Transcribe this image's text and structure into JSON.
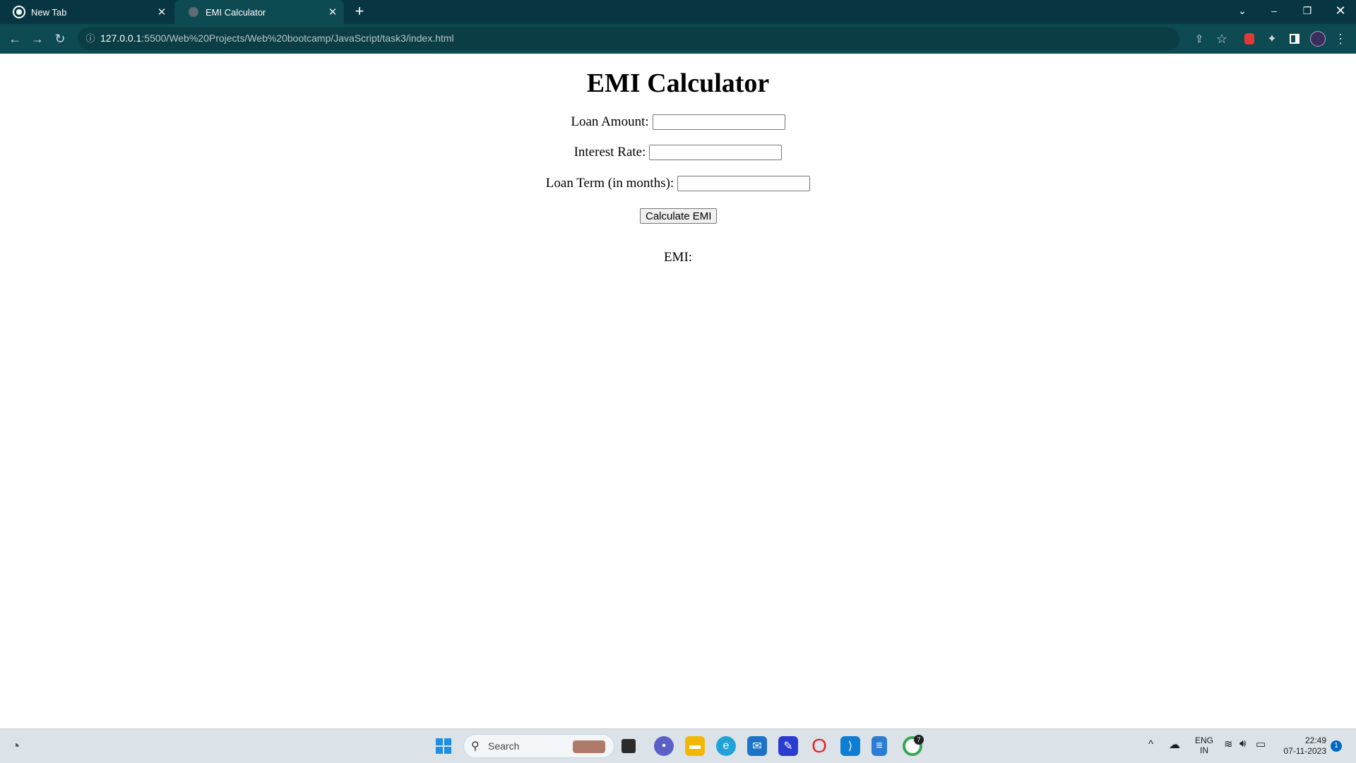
{
  "browser": {
    "tabs": [
      {
        "label": "New Tab",
        "active": false
      },
      {
        "label": "EMI Calculator",
        "active": true
      }
    ],
    "address": {
      "host": "127.0.0.1",
      "rest": ":5500/Web%20Projects/Web%20bootcamp/JavaScript/task3/index.html"
    }
  },
  "page": {
    "heading": "EMI Calculator",
    "fields": [
      {
        "label": "Loan Amount:",
        "value": ""
      },
      {
        "label": "Interest Rate:",
        "value": ""
      },
      {
        "label": "Loan Term (in months):",
        "value": ""
      }
    ],
    "button_label": "Calculate EMI",
    "result_label": "EMI:"
  },
  "taskbar": {
    "search_placeholder": "Search",
    "lang_top": "ENG",
    "lang_bottom": "IN",
    "time": "22:49",
    "date": "07-11-2023",
    "notification_count": "1",
    "chrome_badge": "7"
  },
  "colors": {
    "tabbar": "#073642",
    "toolbar": "#0d4a52",
    "page_bg": "#ffffff",
    "taskbar": "#dce3e8"
  }
}
